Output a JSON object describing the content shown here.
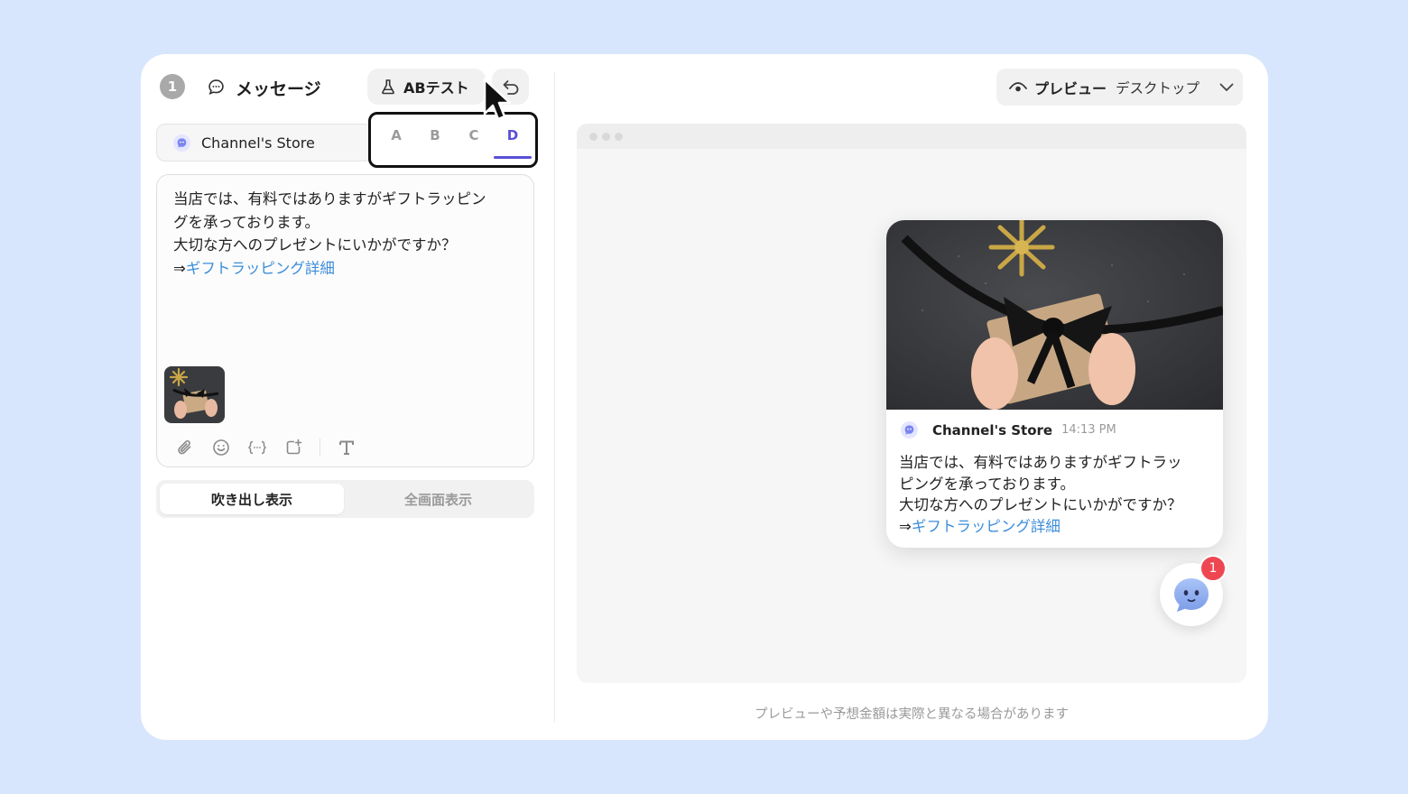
{
  "editor_panel": {
    "step_number": "1",
    "section_title": "メッセージ",
    "ab_test_label": "ABテスト",
    "sender_name": "Channel's Store",
    "variant_tabs": [
      {
        "label": "A",
        "active": false
      },
      {
        "label": "B",
        "active": false
      },
      {
        "label": "C",
        "active": false
      },
      {
        "label": "D",
        "active": true
      }
    ],
    "message_lines": [
      "当店では、有料ではありますがギフトラッピン",
      "グを承っております。",
      "大切な方へのプレゼントにいかがですか？"
    ],
    "link_prefix": "⇒",
    "link_text": "ギフトラッピング詳細",
    "toolbar_icons": [
      "paperclip-icon",
      "emoji-icon",
      "variable-icon",
      "add-button-icon",
      "text-format-icon"
    ],
    "display_modes": {
      "active": "吹き出し表示",
      "inactive": "全画面表示"
    }
  },
  "preview_panel": {
    "preview_label": "プレビュー",
    "device_value": "デスクトップ",
    "card": {
      "sender_name": "Channel's Store",
      "time": "14:13 PM",
      "message_lines": [
        "当店では、有料ではありますがギフトラッ",
        "ピングを承っております。",
        "大切な方へのプレゼントにいかがですか？"
      ],
      "link_prefix": "⇒",
      "link_text": "ギフトラッピング詳細"
    },
    "unread_badge": "1",
    "disclaimer": "プレビューや予想金額は実際と異なる場合があります"
  },
  "colors": {
    "background": "#d8e6fd",
    "accent": "#5b4fd6",
    "link": "#3c8dd9",
    "badge": "#ee4752"
  }
}
